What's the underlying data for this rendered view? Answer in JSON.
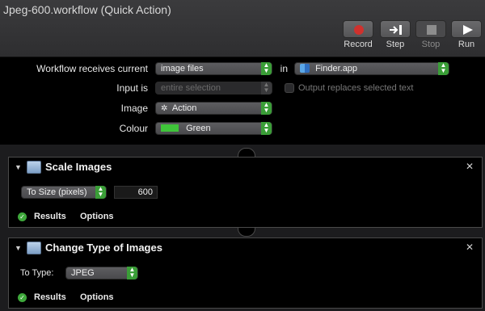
{
  "window": {
    "title": "Jpeg-600.workflow (Quick Action)"
  },
  "toolbar": {
    "record_label": "Record",
    "step_label": "Step",
    "stop_label": "Stop",
    "run_label": "Run"
  },
  "workflow_header": {
    "receives_label": "Workflow receives current",
    "receives_value": "image files",
    "in_label": "in",
    "app_value": "Finder.app",
    "input_is_label": "Input is",
    "input_is_value": "entire selection",
    "output_replaces_label": "Output replaces selected text",
    "image_label": "Image",
    "image_value": "Action",
    "colour_label": "Colour",
    "colour_value": "Green",
    "colour_hex": "#3fc43a"
  },
  "actions": [
    {
      "title": "Scale Images",
      "mode_value": "To Size (pixels)",
      "size_value": "600",
      "results_label": "Results",
      "options_label": "Options"
    },
    {
      "title": "Change Type of Images",
      "to_type_label": "To Type:",
      "to_type_value": "JPEG",
      "results_label": "Results",
      "options_label": "Options"
    }
  ],
  "icons": {
    "close": "close-icon",
    "disclosure": "disclosure-triangle-icon",
    "results_check": "checkmark-icon",
    "action_gear": "gear-icon",
    "finder": "finder-icon"
  },
  "accent_color": "#3a9e37"
}
